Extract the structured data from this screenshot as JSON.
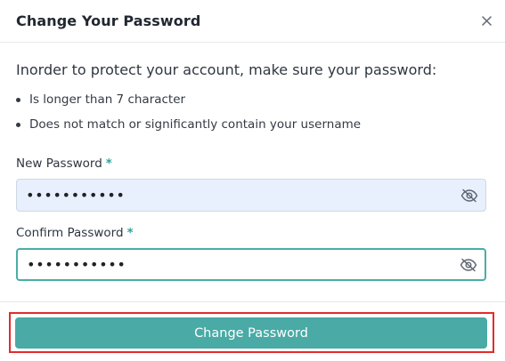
{
  "modal": {
    "title": "Change Your Password"
  },
  "instructions": {
    "intro": "Inorder to protect your account, make sure your password:",
    "rules": [
      "Is longer than 7 character",
      "Does not match or significantly contain your username"
    ]
  },
  "fields": {
    "new_password": {
      "label": "New Password",
      "required_mark": "*",
      "value": "•••••••••••"
    },
    "confirm_password": {
      "label": "Confirm Password",
      "required_mark": "*",
      "value": "•••••••••••"
    }
  },
  "actions": {
    "submit_label": "Change Password"
  },
  "colors": {
    "accent": "#4aaaa5",
    "required": "#2fa39a",
    "highlight": "#e32b2b"
  },
  "icons": {
    "close": "close-icon",
    "toggle_visibility": "eye-off-icon"
  }
}
